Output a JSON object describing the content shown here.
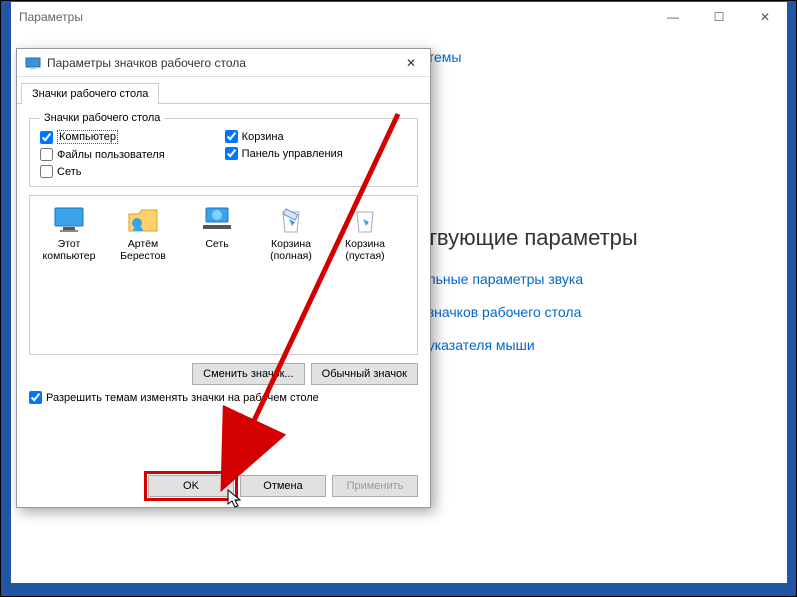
{
  "parent": {
    "title": "Параметры",
    "themeLink": "ры темы",
    "heading": "тствующие параметры",
    "links": [
      "ительные параметры звука",
      "ры значков рабочего стола",
      "ры указателя мыши"
    ]
  },
  "dialog": {
    "title": "Параметры значков рабочего стола",
    "tab": "Значки рабочего стола",
    "group": "Значки рабочего стола",
    "cb": {
      "computer": "Компьютер",
      "userfiles": "Файлы пользователя",
      "network": "Сеть",
      "recycle": "Корзина",
      "cpanel": "Панель управления"
    },
    "state": {
      "computer": true,
      "userfiles": false,
      "network": false,
      "recycle": true,
      "cpanel": true
    },
    "icons": {
      "thispc": "Этот компьютер",
      "user": "Артём Берестов",
      "net": "Сеть",
      "binfull": "Корзина (полная)",
      "binempty": "Корзина (пустая)"
    },
    "changeIcon": "Сменить значок...",
    "defaultIcon": "Обычный значок",
    "allowThemes": "Разрешить темам изменять значки на рабочем столе",
    "allowThemesChecked": true,
    "ok": "OK",
    "cancel": "Отмена",
    "apply": "Применить"
  }
}
